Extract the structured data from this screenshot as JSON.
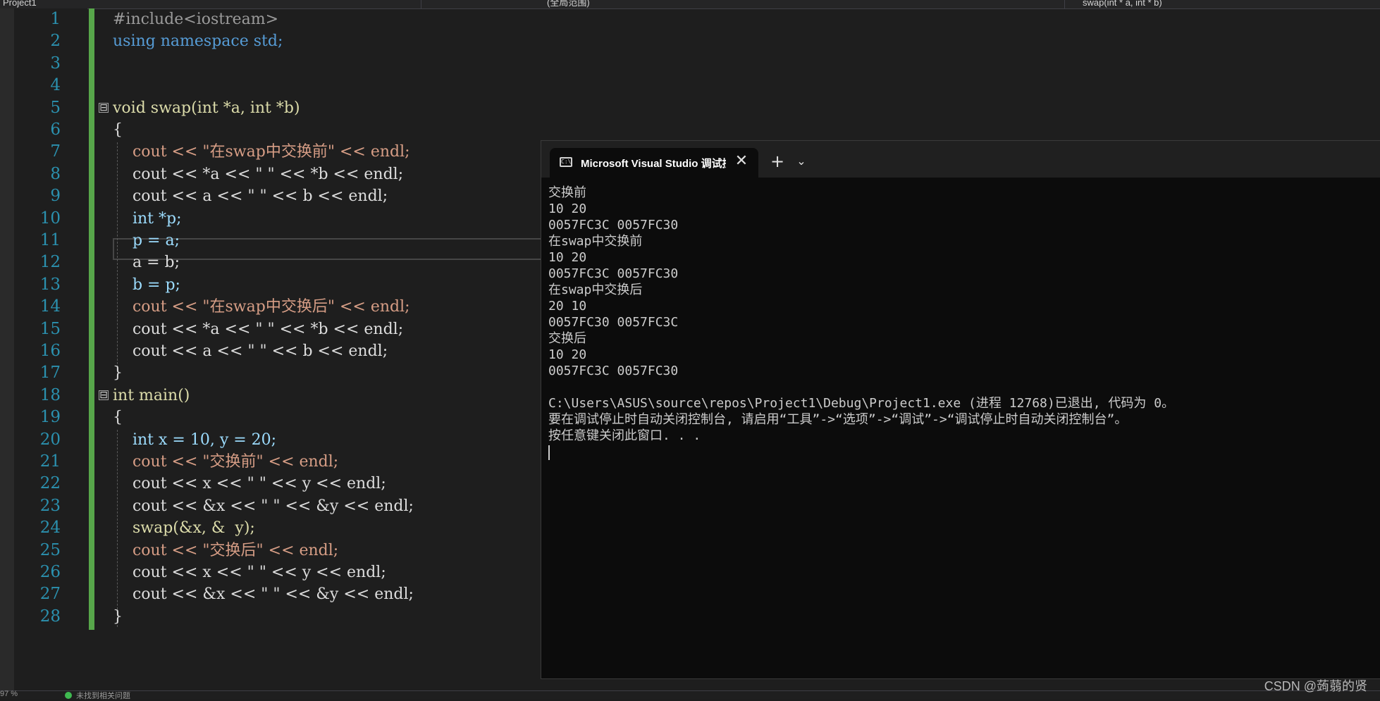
{
  "navbar": {
    "project": "Project1",
    "scope": "(全局范围)",
    "function": "swap(int * a, int * b)"
  },
  "editor": {
    "line_numbers": [
      "1",
      "2",
      "3",
      "4",
      "5",
      "6",
      "7",
      "8",
      "9",
      "10",
      "11",
      "12",
      "13",
      "14",
      "15",
      "16",
      "17",
      "18",
      "19",
      "20",
      "21",
      "22",
      "23",
      "24",
      "25",
      "26",
      "27",
      "28"
    ],
    "lines": [
      "#include<iostream>",
      "using namespace std;",
      "",
      "",
      "void swap(int *a, int *b)",
      "{",
      "    cout << \"在swap中交换前\" << endl;",
      "    cout << *a << \" \" << *b << endl;",
      "    cout << a << \" \" << b << endl;",
      "    int *p;",
      "    p = a;",
      "    a = b;",
      "    b = p;",
      "    cout << \"在swap中交换后\" << endl;",
      "    cout << *a << \" \" << *b << endl;",
      "    cout << a << \" \" << b << endl;",
      "}",
      "int main()",
      "{",
      "    int x = 10, y = 20;",
      "    cout << \"交换前\" << endl;",
      "    cout << x << \" \" << y << endl;",
      "    cout << &x << \" \" << &y << endl;",
      "    swap(&x, &  y);",
      "    cout << \"交换后\" << endl;",
      "    cout << x << \" \" << y << endl;",
      "    cout << &x << \" \" << &y << endl;",
      "}"
    ],
    "fold_markers": [
      "⊟",
      "⊟"
    ]
  },
  "console": {
    "tab_title": "Microsoft Visual Studio 调试控制台",
    "close_glyph": "✕",
    "new_tab_glyph": "+",
    "dropdown_glyph": "⌄",
    "icon_text": "C:\\",
    "output": [
      "交换前",
      "10 20",
      "0057FC3C 0057FC30",
      "在swap中交换前",
      "10 20",
      "0057FC3C 0057FC30",
      "在swap中交换后",
      "20 10",
      "0057FC30 0057FC3C",
      "交换后",
      "10 20",
      "0057FC3C 0057FC30",
      "",
      "C:\\Users\\ASUS\\source\\repos\\Project1\\Debug\\Project1.exe (进程 12768)已退出, 代码为 0。",
      "要在调试停止时自动关闭控制台, 请启用“工具”->“选项”->“调试”->“调试停止时自动关闭控制台”。",
      "按任意键关闭此窗口. . ."
    ]
  },
  "status": {
    "zoom": "97 %",
    "message": "未找到相关问题"
  },
  "watermark": "CSDN @蒟蒻的贤",
  "colors": {
    "editor_bg": "#1e1e1e",
    "line_number": "#2b91af",
    "keyword": "#569cd6",
    "string": "#d69d85",
    "function": "#dcdcaa",
    "variable": "#9cdcfe",
    "change_bar": "#57a64a",
    "console_bg": "#0c0c0c"
  }
}
